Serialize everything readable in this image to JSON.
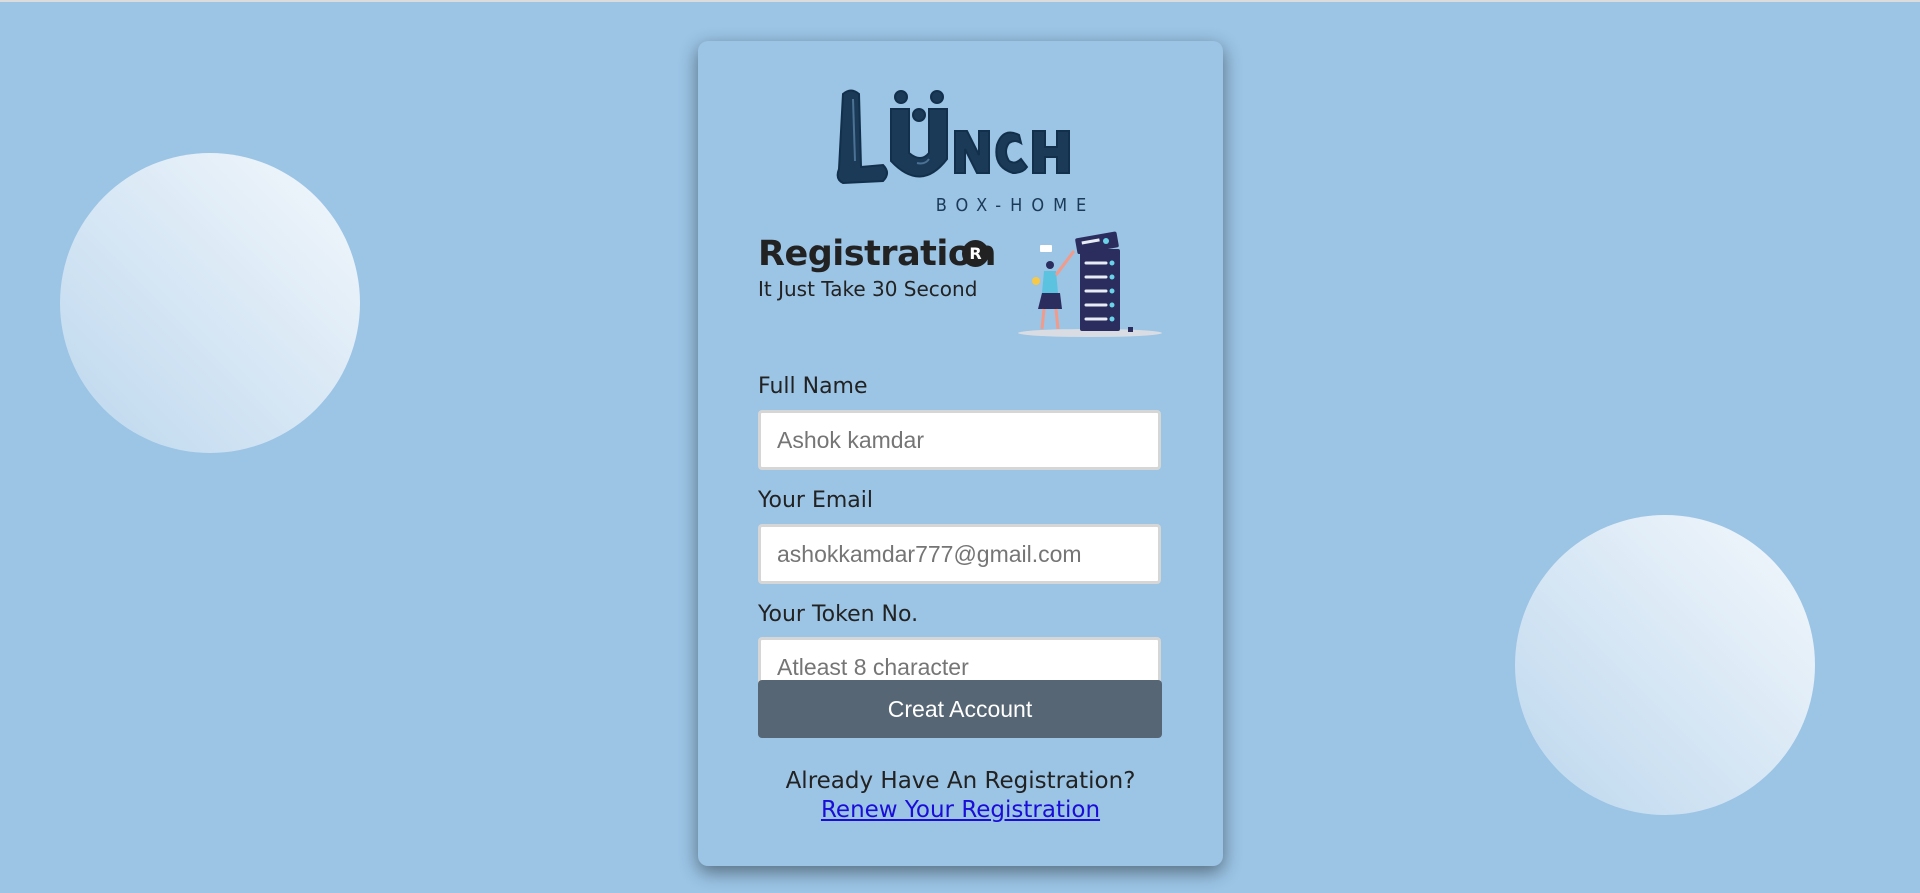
{
  "brand": {
    "logo_text": "LUNCH",
    "logo_subtitle": "BOX-HOME"
  },
  "form": {
    "title": "Registration",
    "title_badge": "R",
    "subtitle": "It Just Take 30 Second",
    "fields": [
      {
        "label": "Full Name",
        "value": "",
        "placeholder": "Ashok kamdar"
      },
      {
        "label": "Your Email",
        "value": "",
        "placeholder": "ashokkamdar777@gmail.com"
      },
      {
        "label": "Your Token No.",
        "value": "",
        "placeholder": "Atleast 8 character"
      }
    ],
    "submit_label": "Creat Account"
  },
  "footer": {
    "question": "Already Have An Registration?",
    "link_text": "Renew Your Registration"
  },
  "colors": {
    "background": "#9bc4e5",
    "button": "#566674",
    "logo": "#1b3a57",
    "link": "#1a0dd9"
  },
  "icons": {
    "illustration": "person-with-server-rack-illustration",
    "badge": "registered-trademark-icon"
  }
}
